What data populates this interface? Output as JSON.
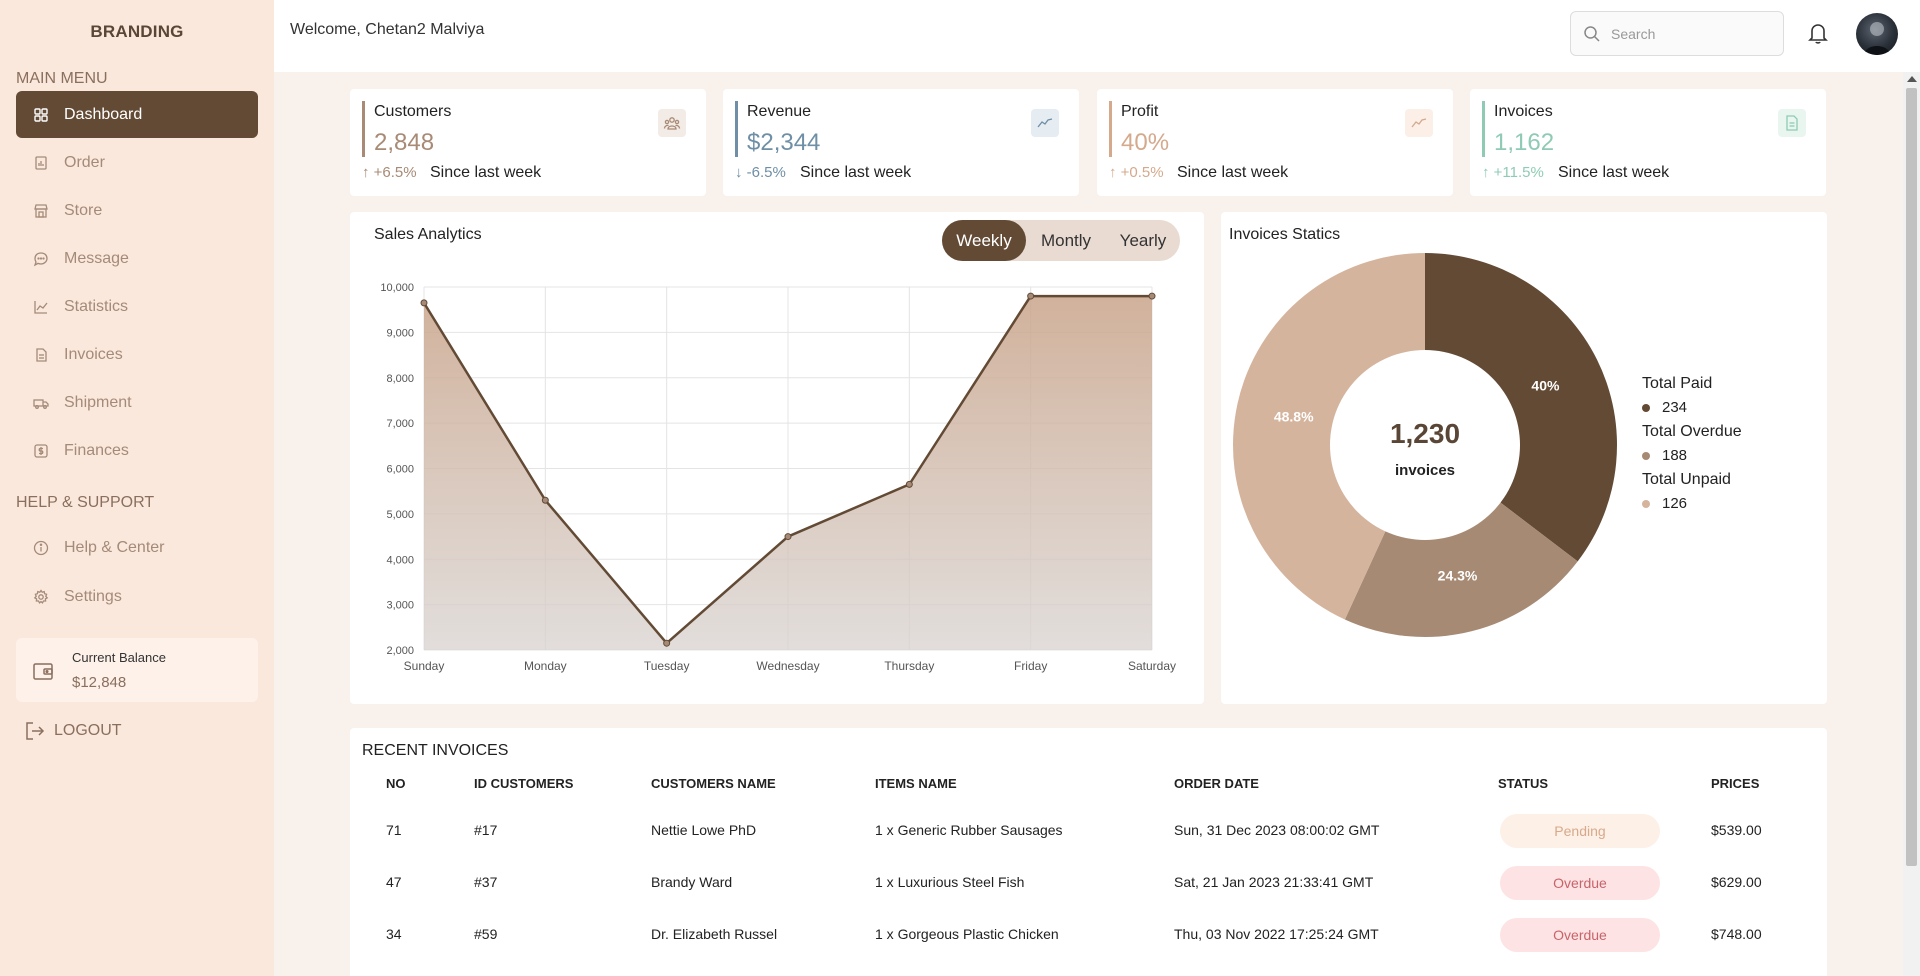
{
  "sidebar": {
    "brand": "BRANDING",
    "main_menu_label": "MAIN MENU",
    "items": [
      {
        "label": "Dashboard",
        "icon": "grid-icon"
      },
      {
        "label": "Order",
        "icon": "order-icon"
      },
      {
        "label": "Store",
        "icon": "store-icon"
      },
      {
        "label": "Message",
        "icon": "message-icon"
      },
      {
        "label": "Statistics",
        "icon": "statistics-icon"
      },
      {
        "label": "Invoices",
        "icon": "invoice-icon"
      },
      {
        "label": "Shipment",
        "icon": "shipment-icon"
      },
      {
        "label": "Finances",
        "icon": "finance-icon"
      }
    ],
    "help_label": "HELP & SUPPORT",
    "help_items": [
      {
        "label": "Help & Center",
        "icon": "info-icon"
      },
      {
        "label": "Settings",
        "icon": "gear-icon"
      }
    ],
    "balance": {
      "label": "Current Balance",
      "value": "$12,848"
    },
    "logout_label": "LOGOUT"
  },
  "header": {
    "welcome": "Welcome, Chetan2 Malviya",
    "search_placeholder": "Search"
  },
  "stats": [
    {
      "title": "Customers",
      "value": "2,848",
      "trend": "↑ +6.5%",
      "since": "Since last week",
      "color": "#a88a76",
      "icon": "users-icon"
    },
    {
      "title": "Revenue",
      "value": "$2,344",
      "trend": "↓ -6.5%",
      "since": "Since last week",
      "color": "#6e8fa6",
      "icon": "line-chart-icon"
    },
    {
      "title": "Profit",
      "value": "40%",
      "trend": "↑ +0.5%",
      "since": "Since last week",
      "color": "#d4a98c",
      "icon": "line-chart-icon"
    },
    {
      "title": "Invoices",
      "value": "1,162",
      "trend": "↑ +11.5%",
      "since": "Since last week",
      "color": "#8fcbb4",
      "icon": "document-icon"
    }
  ],
  "sales": {
    "title": "Sales Analytics",
    "toggle": [
      "Weekly",
      "Montly",
      "Yearly"
    ],
    "active_toggle": "Weekly"
  },
  "invoices_card": {
    "title": "Invoices Statics",
    "center_value": "1,230",
    "center_label": "invoices"
  },
  "chart_data": [
    {
      "type": "area",
      "title": "Sales Analytics",
      "categories": [
        "Sunday",
        "Monday",
        "Tuesday",
        "Wednesday",
        "Thursday",
        "Friday",
        "Saturday"
      ],
      "values": [
        9650,
        5300,
        2150,
        4500,
        5650,
        9800,
        9800
      ],
      "ylim": [
        2000,
        10000
      ],
      "yticks": [
        "2,000",
        "3,000",
        "4,000",
        "5,000",
        "6,000",
        "7,000",
        "8,000",
        "9,000",
        "10,000"
      ],
      "grid": true,
      "color": "#634a35"
    },
    {
      "type": "pie",
      "title": "Invoices Statics",
      "series": [
        {
          "name": "Total Paid",
          "value": 234,
          "percent": "40%",
          "color": "#634a35"
        },
        {
          "name": "Total Overdue",
          "value": 188,
          "percent": "24.3%",
          "color": "#a78a74"
        },
        {
          "name": "Total Unpaid",
          "value": 126,
          "percent": "48.8%",
          "color": "#d5b49d"
        }
      ],
      "legend_position": "right"
    }
  ],
  "recent": {
    "title": "RECENT INVOICES",
    "columns": [
      "NO",
      "ID CUSTOMERS",
      "CUSTOMERS NAME",
      "ITEMS NAME",
      "ORDER DATE",
      "STATUS",
      "PRICES"
    ],
    "rows": [
      {
        "no": "71",
        "id": "#17",
        "name": "Nettie Lowe PhD",
        "item": "1 x Generic Rubber Sausages",
        "date": "Sun, 31 Dec 2023 08:00:02 GMT",
        "status": "Pending",
        "price": "$539.00"
      },
      {
        "no": "47",
        "id": "#37",
        "name": "Brandy Ward",
        "item": "1 x Luxurious Steel Fish",
        "date": "Sat, 21 Jan 2023 21:33:41 GMT",
        "status": "Overdue",
        "price": "$629.00"
      },
      {
        "no": "34",
        "id": "#59",
        "name": "Dr. Elizabeth Russel",
        "item": "1 x Gorgeous Plastic Chicken",
        "date": "Thu, 03 Nov 2022 17:25:24 GMT",
        "status": "Overdue",
        "price": "$748.00"
      }
    ]
  }
}
